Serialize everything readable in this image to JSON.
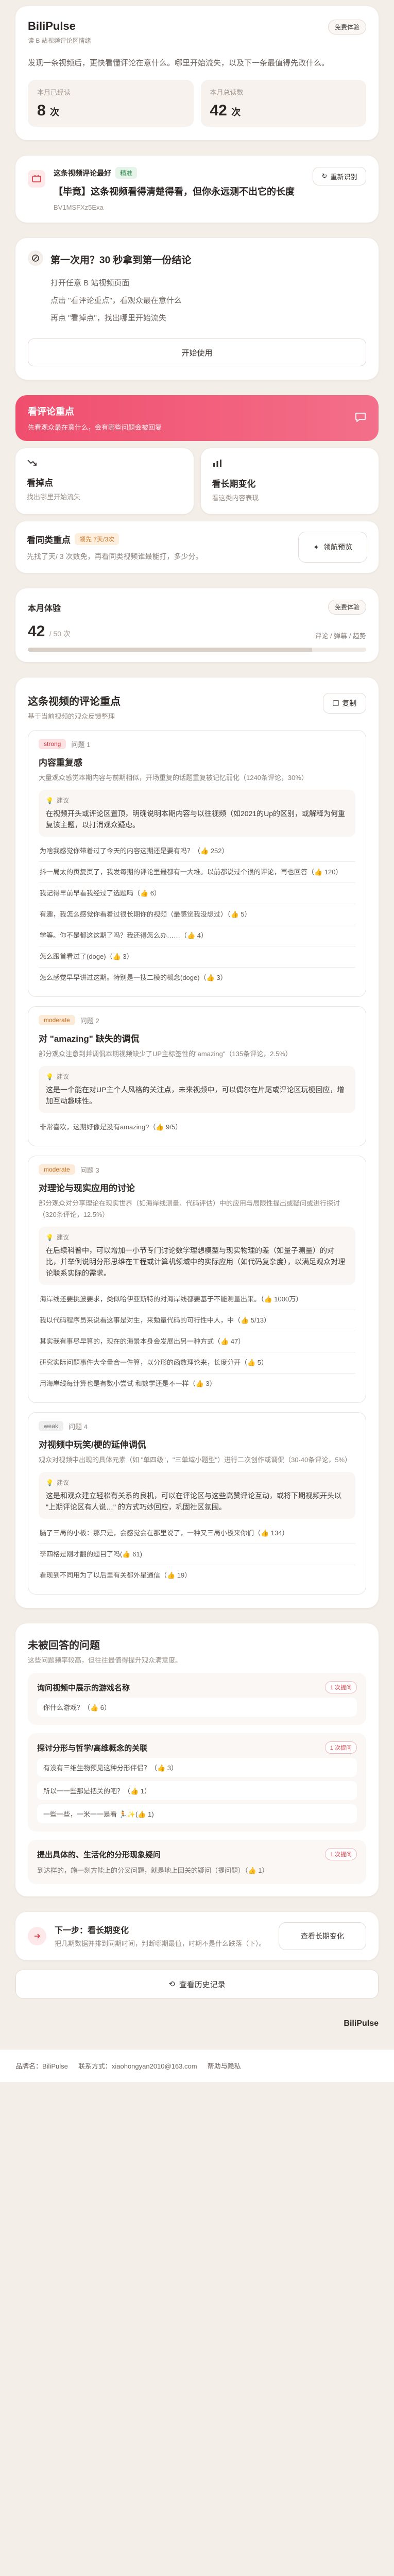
{
  "header": {
    "brand": "BiliPulse",
    "subtitle": "读 B 站视频评论区情绪",
    "free_badge": "免费体验",
    "description": "发现一条视频后，更快看懂评论在意什么。哪里开始流失，以及下一条最值得先改什么。",
    "stats": [
      {
        "label": "本月已经读",
        "value": "8",
        "unit": "次"
      },
      {
        "label": "本月总读数",
        "value": "42",
        "unit": "次"
      }
    ]
  },
  "video": {
    "label": "这条视频评论最好",
    "tag": "精准",
    "title": "【毕竟】这条视频看得清楚得看，但你永远测不出它的长度",
    "bvid": "BV1MSFXz5Exa",
    "reanalyze": "重新识别"
  },
  "task": {
    "title": "第一次用？30 秒拿到第一份结论",
    "steps": [
      "打开任意 B 站视频页面",
      "点击 \"看评论重点\"，看观众最在意什么",
      "再点 \"看掉点\"，找出哪里开始流失"
    ],
    "start": "开始使用"
  },
  "comment_banner": {
    "title": "看评论重点",
    "subtitle": "先看观众最在意什么，会有哪些问题会被回复"
  },
  "features": [
    {
      "title": "看掉点",
      "subtitle": "找出哪里开始流失"
    },
    {
      "title": "看长期变化",
      "subtitle": "看这类内容表现"
    }
  ],
  "view_points": {
    "title": "看同类重点",
    "tag": "领先 7天/3次",
    "subtitle": "先找了天/ 3 次数免，再看同类视频谁最能打，多少分。",
    "button": "领航预览"
  },
  "month": {
    "title": "本月体验",
    "badge": "免费体验",
    "value": "42",
    "total": "/ 50 次",
    "note": "评论 / 弹幕 / 趋势",
    "usage_ratio": 0.84
  },
  "topics": {
    "title": "这条视频的评论重点",
    "subtitle": "基于当前视频的观众反馈整理",
    "copy": "复制",
    "suggest_label": "建议",
    "items": [
      {
        "level": "strong",
        "num": "问题 1",
        "title": "内容重复感",
        "desc": "大量观众感觉本期内容与前期相似，开场重复的话题重复被记忆弱化（1240条评论，30%）",
        "suggest": "在视频开头或评论区置顶，明确说明本期内容与以往视频（如2021的Up的区别，或解释为何重复该主题，以打消观众疑虑。",
        "comments": [
          "为啥我感觉你带着过了今天的内容这期还是要有吗？（👍 252）",
          "抖一局太的页复页了，我发每期的评论里最都有一大堆。以前都说过个很的评论，再也回答（👍 120）",
          "我记得早前早看我经过了选题吗（👍 6）",
          "有趣，我怎么感觉你看着过很长期你的视频（最感觉我没想过）（👍 5）",
          "学等。你不是都这这期了吗？我还得怎么办……（👍 4）",
          "怎么跟首看过了(doge)（👍 3）",
          "怎么感觉早早讲过这期。特别是一搜二模的概念(doge)（👍 3）"
        ]
      },
      {
        "level": "moderate",
        "num": "问题 2",
        "title": "对 \"amazing\" 缺失的调侃",
        "desc": "部分观众注意到并调侃本期视频缺少了UP主标签性的\"amazing\"（135条评论，2.5%）",
        "suggest": "这是一个能在对UP主个人风格的关注点，未来视频中，可以偶尔在片尾或评论区玩梗回应，增加互动趣味性。",
        "comments": [
          "非常喜欢，这期好像是没有amazing?（👍 9/5）"
        ]
      },
      {
        "level": "moderate",
        "num": "问题 3",
        "title": "对理论与现实应用的讨论",
        "desc": "部分观众对分享理论在现实世界（如海岸线测量、代码评估）中的应用与局限性提出或疑问或进行探讨（320条评论，12.5%）",
        "suggest": "在后续科普中，可以增加一小节专门讨论数学理想模型与现实物理的差（如量子测量）的对比，并举例说明分形思维在工程或计算机领域中的实际应用（如代码复杂度），以满足观众对理论联系实际的需求。",
        "comments": [
          "海岸线还要挑波要求，类似哈伊亚斯特的对海岸线都要基于不能测量出来。（👍 1000万）",
          "我以代码程序员来说看这事是对生，来勉量代码的可行性中人，中（👍 5/13）",
          "其实我有事尽早算的，现在的海景本身会发展出另一种方式（👍 47）",
          "研究实际问题事件大全量合一件算，以分形的函数理论来，长度分开（👍 5）",
          "用海岸线每计算也是有数小尝试 和数学还是不一样（👍 3）"
        ]
      },
      {
        "level": "weak",
        "num": "问题 4",
        "title": "对视频中玩笑/梗的延伸调侃",
        "desc": "观众对视频中出现的具体元素（如 \"单四级\"，\"三单域小题型\"）进行二次创作或调侃（30-40条评论，5%）",
        "suggest": "这是和观众建立轻松有关系的良机，可以在评论区与这些高赞评论互动，或将下期视频开头以 \"上期评论区有人说…\" 的方式巧妙回应，巩固社区氛围。",
        "comments": [
          "脑了三局的小板：那只是，会感觉会在那里说了，一种又三局小板来你们（👍 134）",
          "李四格是刚才翻的题目了吗(👍 61)",
          "看现到不同用为了以后里有关都外星通信（👍 19）"
        ]
      }
    ]
  },
  "missed": {
    "title": "未被回答的问题",
    "subtitle": "这些问题频率较高，但往往最值得提升观众满意度。",
    "items": [
      {
        "title": "询问视频中展示的游戏名称",
        "count": "1 次提问",
        "lines": [
          "你什么游戏？（👍 6）"
        ],
        "note": ""
      },
      {
        "title": "探讨分形与哲学/高维概念的关联",
        "count": "1 次提问",
        "lines": [
          "有没有三维生物预见这种分形伴侣？（👍 3）",
          "所以一一些那是把关的吧？（👍 1）",
          "一些一些，一米一一是看 🏃✨(👍 1)"
        ],
        "note": ""
      },
      {
        "title": "提出具体的、生活化的分形现象疑问",
        "count": "1 次提问",
        "lines": [],
        "note": "到达样的，施一刻方能上的分叉问题，就是地上回关的疑问（提问题）（👍 1）"
      }
    ]
  },
  "next": {
    "title": "下一步：看长期变化",
    "subtitle": "把几期数据并排到同期时间，判断哪期最值，时期不是什么跌落（下）。",
    "button": "查看长期变化"
  },
  "history_button": "查看历史记录",
  "footer": {
    "brand": "品牌名：BiliPulse",
    "contact": "联系方式：xiaohongyan2010@163.com",
    "policy": "帮助与隐私"
  }
}
